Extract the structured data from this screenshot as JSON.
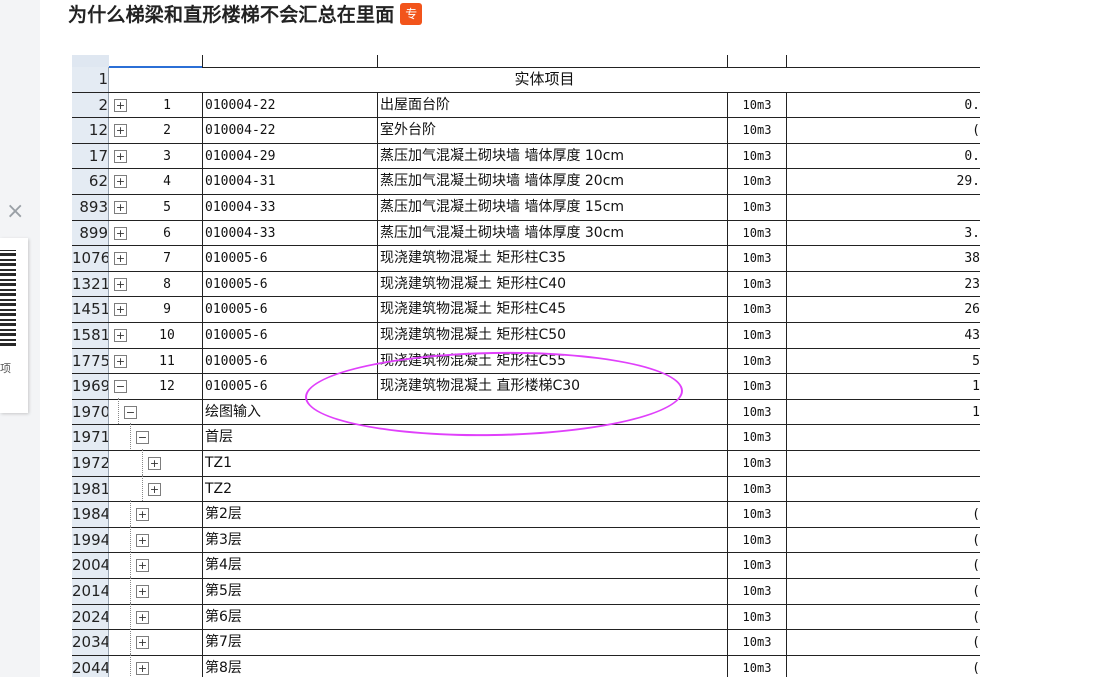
{
  "post": {
    "title": "为什么梯梁和直形楼梯不会汇总在里面",
    "badge": "专"
  },
  "side_panel": {
    "close_glyph": "×",
    "qr_caption": "项"
  },
  "table": {
    "merged_header": "实体项目",
    "rows": [
      {
        "rownum": "2",
        "toggle": "+",
        "seq": "1",
        "code": "010004-22",
        "name": "出屋面台阶",
        "unit": "10m3",
        "qty": "0."
      },
      {
        "rownum": "12",
        "toggle": "+",
        "seq": "2",
        "code": "010004-22",
        "name": "室外台阶",
        "unit": "10m3",
        "qty": "("
      },
      {
        "rownum": "17",
        "toggle": "+",
        "seq": "3",
        "code": "010004-29",
        "name": "蒸压加气混凝土砌块墙 墙体厚度 10cm",
        "unit": "10m3",
        "qty": "0."
      },
      {
        "rownum": "62",
        "toggle": "+",
        "seq": "4",
        "code": "010004-31",
        "name": "蒸压加气混凝土砌块墙 墙体厚度 20cm",
        "unit": "10m3",
        "qty": "29."
      },
      {
        "rownum": "893",
        "toggle": "+",
        "seq": "5",
        "code": "010004-33",
        "name": "蒸压加气混凝土砌块墙 墙体厚度 15cm",
        "unit": "10m3",
        "qty": ""
      },
      {
        "rownum": "899",
        "toggle": "+",
        "seq": "6",
        "code": "010004-33",
        "name": "蒸压加气混凝土砌块墙 墙体厚度 30cm",
        "unit": "10m3",
        "qty": "3."
      },
      {
        "rownum": "1076",
        "toggle": "+",
        "seq": "7",
        "code": "010005-6",
        "name": "现浇建筑物混凝土 矩形柱C35",
        "unit": "10m3",
        "qty": "38"
      },
      {
        "rownum": "1321",
        "toggle": "+",
        "seq": "8",
        "code": "010005-6",
        "name": "现浇建筑物混凝土 矩形柱C40",
        "unit": "10m3",
        "qty": "23"
      },
      {
        "rownum": "1451",
        "toggle": "+",
        "seq": "9",
        "code": "010005-6",
        "name": "现浇建筑物混凝土 矩形柱C45",
        "unit": "10m3",
        "qty": "26"
      },
      {
        "rownum": "1581",
        "toggle": "+",
        "seq": "10",
        "code": "010005-6",
        "name": "现浇建筑物混凝土 矩形柱C50",
        "unit": "10m3",
        "qty": "43"
      },
      {
        "rownum": "1775",
        "toggle": "+",
        "seq": "11",
        "code": "010005-6",
        "name": "现浇建筑物混凝土 矩形柱C55",
        "unit": "10m3",
        "qty": "5"
      },
      {
        "rownum": "1969",
        "toggle": "−",
        "seq": "12",
        "code": "010005-6",
        "name": "现浇建筑物混凝土 直形楼梯C30",
        "unit": "10m3",
        "qty": "1"
      }
    ],
    "tree_rows": [
      {
        "rownum": "1970",
        "toggle": "−",
        "name": "绘图输入",
        "unit": "10m3",
        "qty": "1",
        "level": 1
      },
      {
        "rownum": "1971",
        "toggle": "−",
        "name": "首层",
        "unit": "10m3",
        "qty": "",
        "level": 2
      },
      {
        "rownum": "1972",
        "toggle": "+",
        "name": "TZ1",
        "unit": "10m3",
        "qty": "",
        "level": 3
      },
      {
        "rownum": "1981",
        "toggle": "+",
        "name": "TZ2",
        "unit": "10m3",
        "qty": "",
        "level": 3
      },
      {
        "rownum": "1984",
        "toggle": "+",
        "name": "第2层",
        "unit": "10m3",
        "qty": "(",
        "level": 2
      },
      {
        "rownum": "1994",
        "toggle": "+",
        "name": "第3层",
        "unit": "10m3",
        "qty": "(",
        "level": 2
      },
      {
        "rownum": "2004",
        "toggle": "+",
        "name": "第4层",
        "unit": "10m3",
        "qty": "(",
        "level": 2
      },
      {
        "rownum": "2014",
        "toggle": "+",
        "name": "第5层",
        "unit": "10m3",
        "qty": "(",
        "level": 2
      },
      {
        "rownum": "2024",
        "toggle": "+",
        "name": "第6层",
        "unit": "10m3",
        "qty": "(",
        "level": 2
      },
      {
        "rownum": "2034",
        "toggle": "+",
        "name": "第7层",
        "unit": "10m3",
        "qty": "(",
        "level": 2
      },
      {
        "rownum": "2044",
        "toggle": "+",
        "name": "第8层",
        "unit": "10m3",
        "qty": "(",
        "level": 2
      }
    ]
  },
  "annotation": {
    "color": "#e040fb"
  }
}
